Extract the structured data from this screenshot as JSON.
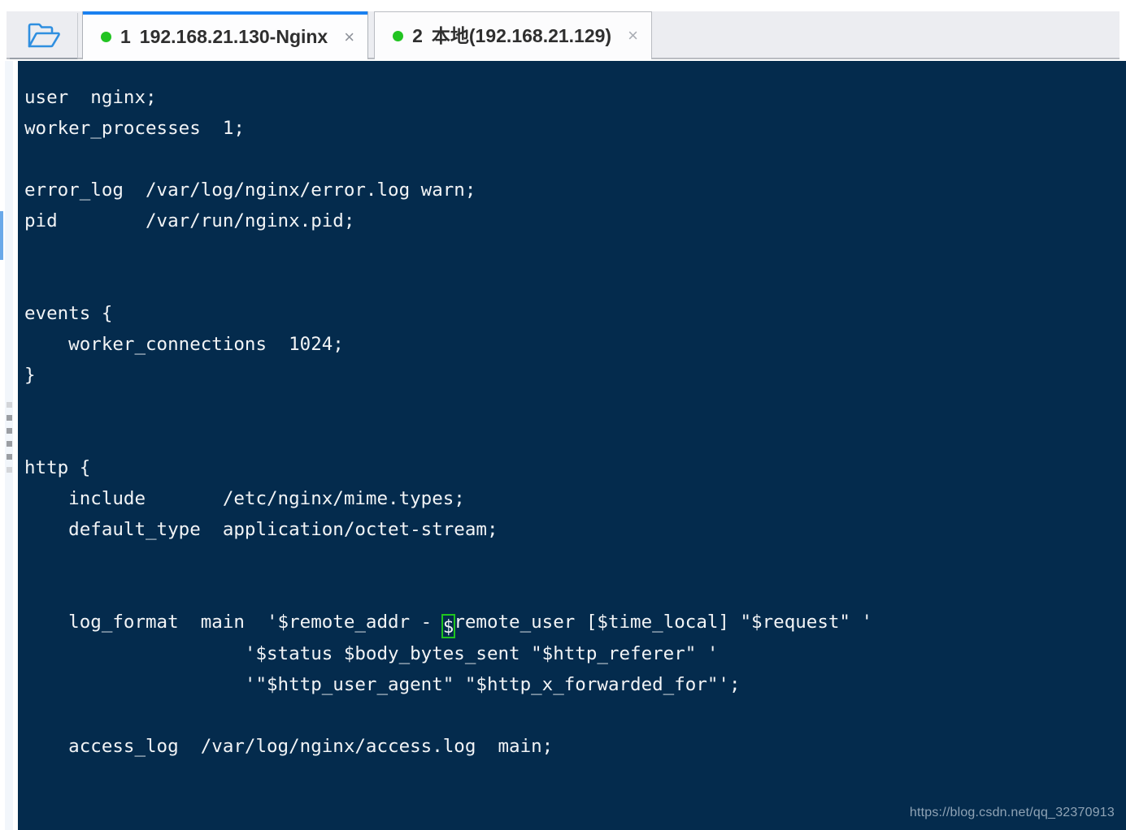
{
  "window": {
    "folder_button_icon": "open-folder-icon"
  },
  "tabs": [
    {
      "index": "1",
      "title": "192.168.21.130-Nginx",
      "status_color": "#22c422",
      "active": true,
      "close_label": "×"
    },
    {
      "index": "2",
      "title": "本地(192.168.21.129)",
      "status_color": "#22c422",
      "active": false,
      "close_label": "×"
    }
  ],
  "theme": {
    "terminal_background": "#042b4d",
    "terminal_foreground": "#f2f4f6",
    "cursor_color": "#1fc41f",
    "active_tab_accent": "#1a80f0",
    "folder_icon_color": "#2f8fe0"
  },
  "terminal": {
    "lines": [
      "user  nginx;",
      "worker_processes  1;",
      "",
      "error_log  /var/log/nginx/error.log warn;",
      "pid        /var/run/nginx.pid;",
      "",
      "",
      "events {",
      "    worker_connections  1024;",
      "}",
      "",
      "",
      "http {",
      "    include       /etc/nginx/mime.types;",
      "    default_type  application/octet-stream;",
      "",
      "",
      "                    '$status $body_bytes_sent \"$http_referer\" '",
      "                    '\"$http_user_agent\" \"$http_x_forwarded_for\"';",
      "",
      "    access_log  /var/log/nginx/access.log  main;"
    ],
    "cursor_line": {
      "before": "    log_format  main  '$remote_addr - ",
      "cursor_char": "$",
      "after": "remote_user [$time_local] \"$request\" '"
    }
  },
  "watermark": {
    "text": "https://blog.csdn.net/qq_32370913"
  }
}
